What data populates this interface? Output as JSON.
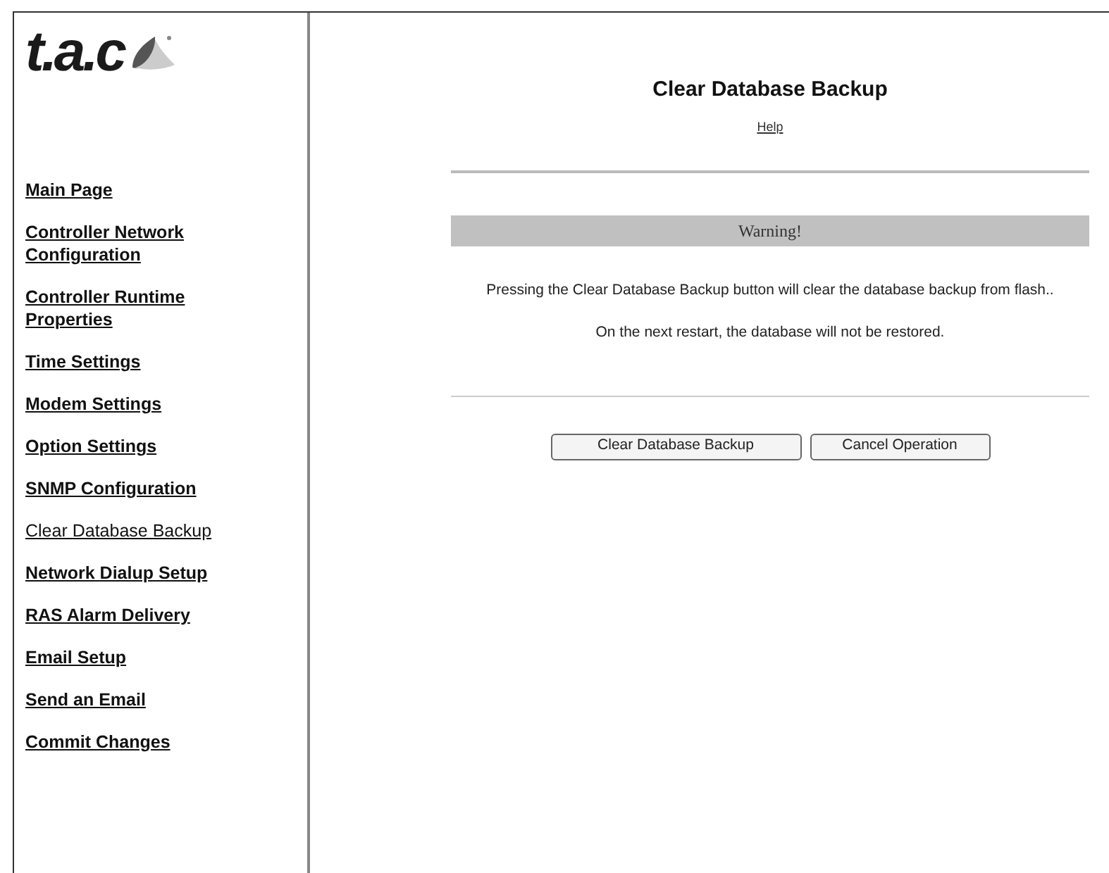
{
  "logo": {
    "text": "t.a.c"
  },
  "nav": [
    {
      "label": "Main Page",
      "selected": false
    },
    {
      "label": "Controller Network Configuration",
      "selected": false
    },
    {
      "label": "Controller Runtime Properties",
      "selected": false
    },
    {
      "label": "Time Settings",
      "selected": false
    },
    {
      "label": "Modem Settings",
      "selected": false
    },
    {
      "label": "Option Settings",
      "selected": false
    },
    {
      "label": "SNMP Configuration",
      "selected": false
    },
    {
      "label": "Clear Database Backup",
      "selected": true
    },
    {
      "label": "Network Dialup Setup",
      "selected": false
    },
    {
      "label": "RAS Alarm Delivery",
      "selected": false
    },
    {
      "label": "Email Setup",
      "selected": false
    },
    {
      "label": "Send an Email",
      "selected": false
    },
    {
      "label": "Commit Changes",
      "selected": false
    }
  ],
  "page": {
    "title": "Clear Database Backup",
    "help_link": "Help",
    "warning": "Warning!",
    "messages": [
      "Pressing the Clear Database Backup button will clear the database backup from flash..",
      "On the next restart, the database will not be restored."
    ],
    "buttons": [
      "Clear Database Backup",
      "Cancel Operation"
    ]
  }
}
